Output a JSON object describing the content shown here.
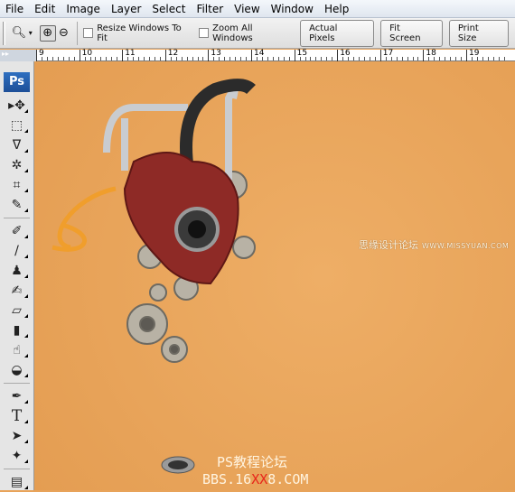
{
  "menu": [
    "File",
    "Edit",
    "Image",
    "Layer",
    "Select",
    "Filter",
    "View",
    "Window",
    "Help"
  ],
  "options": {
    "resize_label": "Resize Windows To Fit",
    "resize_checked": false,
    "zoom_all_label": "Zoom All Windows",
    "zoom_all_checked": false,
    "actual_pixels": "Actual Pixels",
    "fit_screen": "Fit Screen",
    "print_size": "Print Size"
  },
  "ruler": [
    "9",
    "10",
    "11",
    "12",
    "13",
    "14",
    "15",
    "16",
    "17",
    "18",
    "19"
  ],
  "toolbox": {
    "logo": "Ps",
    "tools": [
      "move",
      "marquee",
      "lasso",
      "magic-wand",
      "crop",
      "slice",
      "healing-brush",
      "brush",
      "clone-stamp",
      "history-brush",
      "eraser",
      "gradient",
      "blur",
      "dodge",
      "pen",
      "type",
      "path-selection",
      "custom-shape",
      "notes"
    ]
  },
  "watermarks": {
    "site1_cn": "思缘设计论坛",
    "site1_url": "WWW.MISSYUAN.COM",
    "site2_cn": "PS教程论坛",
    "site2_a": "BBS.16",
    "site2_red": "XX",
    "site2_b": "8.COM"
  },
  "colors": {
    "canvas": "#e8a35a",
    "accent_red": "#e8261b"
  }
}
